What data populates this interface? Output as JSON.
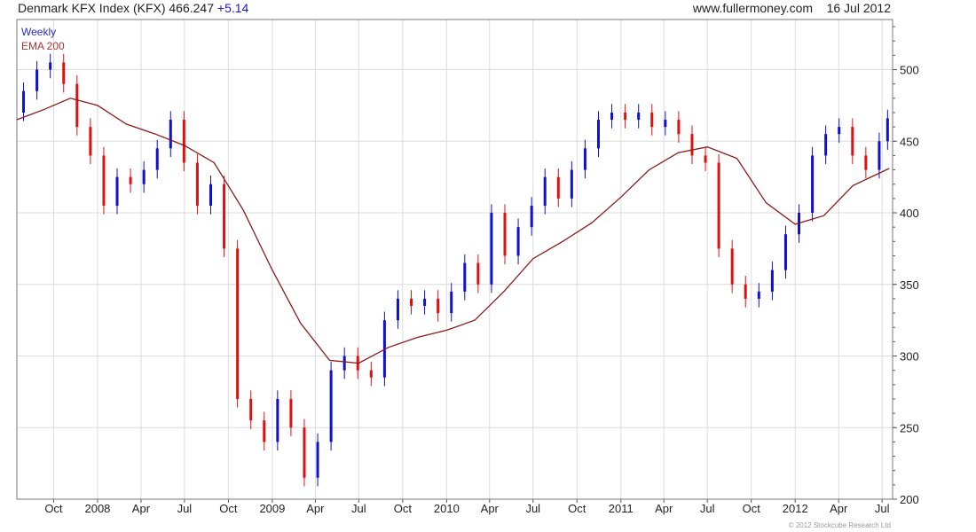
{
  "header": {
    "name": "Denmark KFX Index (KFX)",
    "price": "466.247",
    "change": "+5.14",
    "website": "www.fullermoney.com",
    "date": "16 Jul 2012"
  },
  "legend": {
    "period": "Weekly",
    "ema": "EMA 200"
  },
  "copyright": "© 2012 Stockcube Research Ltd",
  "colors": {
    "up": "#1010d0",
    "down": "#e01010",
    "ema": "#8b1a1a",
    "grid": "#dcdcdc",
    "axis": "#555555"
  },
  "chart_data": {
    "type": "line",
    "title": "Denmark KFX Index (KFX)",
    "ylim": [
      200,
      535
    ],
    "y_ticks": [
      200,
      250,
      300,
      350,
      400,
      450,
      500
    ],
    "x_ticks": [
      {
        "label": "Oct",
        "date": "2007-10-01"
      },
      {
        "label": "2008",
        "date": "2008-01-01"
      },
      {
        "label": "Apr",
        "date": "2008-04-01"
      },
      {
        "label": "Jul",
        "date": "2008-07-01"
      },
      {
        "label": "Oct",
        "date": "2008-10-01"
      },
      {
        "label": "2009",
        "date": "2009-01-01"
      },
      {
        "label": "Apr",
        "date": "2009-04-01"
      },
      {
        "label": "Jul",
        "date": "2009-07-01"
      },
      {
        "label": "Oct",
        "date": "2009-10-01"
      },
      {
        "label": "2010",
        "date": "2010-01-01"
      },
      {
        "label": "Apr",
        "date": "2010-04-01"
      },
      {
        "label": "Jul",
        "date": "2010-07-01"
      },
      {
        "label": "Oct",
        "date": "2010-10-01"
      },
      {
        "label": "2011",
        "date": "2011-01-01"
      },
      {
        "label": "Apr",
        "date": "2011-04-01"
      },
      {
        "label": "Jul",
        "date": "2011-07-01"
      },
      {
        "label": "Oct",
        "date": "2011-10-01"
      },
      {
        "label": "2012",
        "date": "2012-01-01"
      },
      {
        "label": "Apr",
        "date": "2012-04-01"
      },
      {
        "label": "Jul",
        "date": "2012-07-01"
      }
    ],
    "x_range": [
      "2007-07-16",
      "2012-07-23"
    ],
    "grid": true,
    "legend_position": "top-left",
    "series": [
      {
        "name": "Weekly",
        "style": "candlestick-close",
        "dates": [
          "2007-07-16",
          "2007-08-13",
          "2007-09-10",
          "2007-10-08",
          "2007-11-05",
          "2007-12-03",
          "2007-12-31",
          "2008-01-28",
          "2008-02-25",
          "2008-03-24",
          "2008-04-21",
          "2008-05-19",
          "2008-06-16",
          "2008-07-14",
          "2008-08-11",
          "2008-09-08",
          "2008-10-06",
          "2008-11-03",
          "2008-12-01",
          "2008-12-29",
          "2009-01-26",
          "2009-02-23",
          "2009-03-23",
          "2009-04-20",
          "2009-05-18",
          "2009-06-15",
          "2009-07-13",
          "2009-08-10",
          "2009-09-07",
          "2009-10-05",
          "2009-11-02",
          "2009-11-30",
          "2009-12-28",
          "2010-01-25",
          "2010-02-22",
          "2010-03-22",
          "2010-04-19",
          "2010-05-17",
          "2010-06-14",
          "2010-07-12",
          "2010-08-09",
          "2010-09-06",
          "2010-10-04",
          "2010-11-01",
          "2010-11-29",
          "2010-12-27",
          "2011-01-24",
          "2011-02-21",
          "2011-03-21",
          "2011-04-18",
          "2011-05-16",
          "2011-06-13",
          "2011-07-11",
          "2011-08-08",
          "2011-09-05",
          "2011-10-03",
          "2011-10-31",
          "2011-11-28",
          "2011-12-26",
          "2012-01-23",
          "2012-02-20",
          "2012-03-19",
          "2012-04-16",
          "2012-05-14",
          "2012-06-11",
          "2012-07-09",
          "2012-07-16"
        ],
        "values": [
          470,
          485,
          500,
          505,
          490,
          460,
          440,
          405,
          425,
          420,
          430,
          445,
          465,
          435,
          405,
          420,
          375,
          270,
          255,
          240,
          270,
          250,
          215,
          240,
          290,
          300,
          290,
          285,
          325,
          340,
          335,
          340,
          330,
          345,
          365,
          350,
          400,
          370,
          390,
          405,
          425,
          410,
          430,
          445,
          465,
          470,
          465,
          470,
          460,
          465,
          455,
          440,
          435,
          375,
          350,
          340,
          345,
          360,
          385,
          400,
          440,
          455,
          460,
          440,
          430,
          450,
          466
        ]
      },
      {
        "name": "EMA 200",
        "dates": [
          "2007-07-16",
          "2007-09-10",
          "2007-11-05",
          "2008-01-01",
          "2008-03-01",
          "2008-05-01",
          "2008-07-01",
          "2008-09-01",
          "2008-11-01",
          "2009-01-01",
          "2009-03-01",
          "2009-05-01",
          "2009-07-01",
          "2009-09-01",
          "2009-11-01",
          "2010-01-01",
          "2010-03-01",
          "2010-05-01",
          "2010-07-01",
          "2010-09-01",
          "2010-11-01",
          "2011-01-01",
          "2011-03-01",
          "2011-05-01",
          "2011-07-01",
          "2011-09-01",
          "2011-11-01",
          "2012-01-01",
          "2012-03-01",
          "2012-05-01",
          "2012-07-16"
        ],
        "values": [
          465,
          472,
          480,
          475,
          462,
          455,
          447,
          435,
          402,
          360,
          323,
          297,
          295,
          306,
          313,
          318,
          325,
          345,
          368,
          380,
          393,
          411,
          430,
          442,
          446,
          438,
          407,
          392,
          398,
          419,
          431
        ]
      }
    ]
  }
}
